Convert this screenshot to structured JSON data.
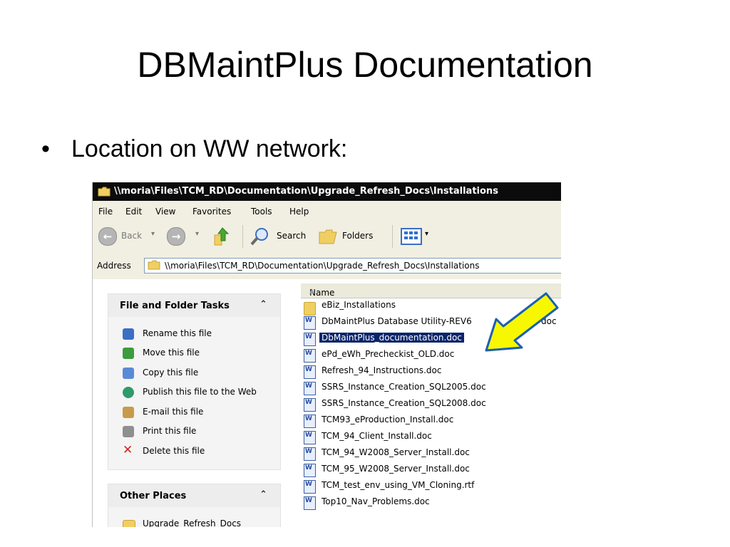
{
  "slide": {
    "title": "DBMaintPlus Documentation",
    "bullet_text": "Location on WW network:",
    "bullet_glyph": "•"
  },
  "window": {
    "title": "\\\\moria\\Files\\TCM_RD\\Documentation\\Upgrade_Refresh_Docs\\Installations",
    "menu": [
      "File",
      "Edit",
      "View",
      "Favorites",
      "Tools",
      "Help"
    ],
    "toolbar": {
      "back_label": "Back",
      "search_label": "Search",
      "folders_label": "Folders",
      "dropdown_glyph": "▾"
    },
    "address": {
      "label": "Address",
      "value": "\\\\moria\\Files\\TCM_RD\\Documentation\\Upgrade_Refresh_Docs\\Installations"
    },
    "tasks_panel": {
      "title": "File and Folder Tasks",
      "collapse_glyph": "⌃",
      "items": [
        {
          "label": "Rename this file",
          "icon": "rename-icon",
          "color": "#3b6fc4"
        },
        {
          "label": "Move this file",
          "icon": "move-icon",
          "color": "#3d9b3d"
        },
        {
          "label": "Copy this file",
          "icon": "copy-icon",
          "color": "#5a8ad6"
        },
        {
          "label": "Publish this file to the Web",
          "icon": "globe-icon",
          "color": "#2f9a6c"
        },
        {
          "label": "E-mail this file",
          "icon": "email-icon",
          "color": "#c79b4a"
        },
        {
          "label": "Print this file",
          "icon": "printer-icon",
          "color": "#8f8f8f"
        },
        {
          "label": "Delete this file",
          "icon": "delete-icon",
          "color": "#d22323"
        }
      ]
    },
    "places_panel": {
      "title": "Other Places",
      "collapse_glyph": "⌃",
      "items": [
        {
          "label": "Upgrade_Refresh_Docs",
          "icon": "folder-icon"
        }
      ]
    },
    "files": {
      "column_header": "Name",
      "sort_glyph": "▲",
      "items": [
        {
          "name": "eBiz_Installations",
          "type": "folder",
          "selected": false
        },
        {
          "name": "DbMaintPlus Database Utility-REV6",
          "type": "doc",
          "selected": false
        },
        {
          "name": "doc",
          "type": "fragment",
          "selected": false
        },
        {
          "name": "DbMaintPlus_documentation.doc",
          "type": "doc",
          "selected": true
        },
        {
          "name": "ePd_eWh_Precheckist_OLD.doc",
          "type": "doc",
          "selected": false
        },
        {
          "name": "Refresh_94_Instructions.doc",
          "type": "doc",
          "selected": false
        },
        {
          "name": "SSRS_Instance_Creation_SQL2005.doc",
          "type": "doc",
          "selected": false
        },
        {
          "name": "SSRS_Instance_Creation_SQL2008.doc",
          "type": "doc",
          "selected": false
        },
        {
          "name": "TCM93_eProduction_Install.doc",
          "type": "doc",
          "selected": false
        },
        {
          "name": "TCM_94_Client_Install.doc",
          "type": "doc",
          "selected": false
        },
        {
          "name": "TCM_94_W2008_Server_Install.doc",
          "type": "doc",
          "selected": false
        },
        {
          "name": "TCM_95_W2008_Server_Install.doc",
          "type": "doc",
          "selected": false
        },
        {
          "name": "TCM_test_env_using_VM_Cloning.rtf",
          "type": "doc",
          "selected": false
        },
        {
          "name": "Top10_Nav_Problems.doc",
          "type": "doc",
          "selected": false
        }
      ]
    }
  },
  "annotation": {
    "type": "arrow",
    "fill": "#f7f700",
    "stroke": "#1a5fb4"
  },
  "colors": {
    "selection": "#0a246a",
    "window_chrome": "#f1efe2",
    "titlebar": "#0b0b0b"
  }
}
